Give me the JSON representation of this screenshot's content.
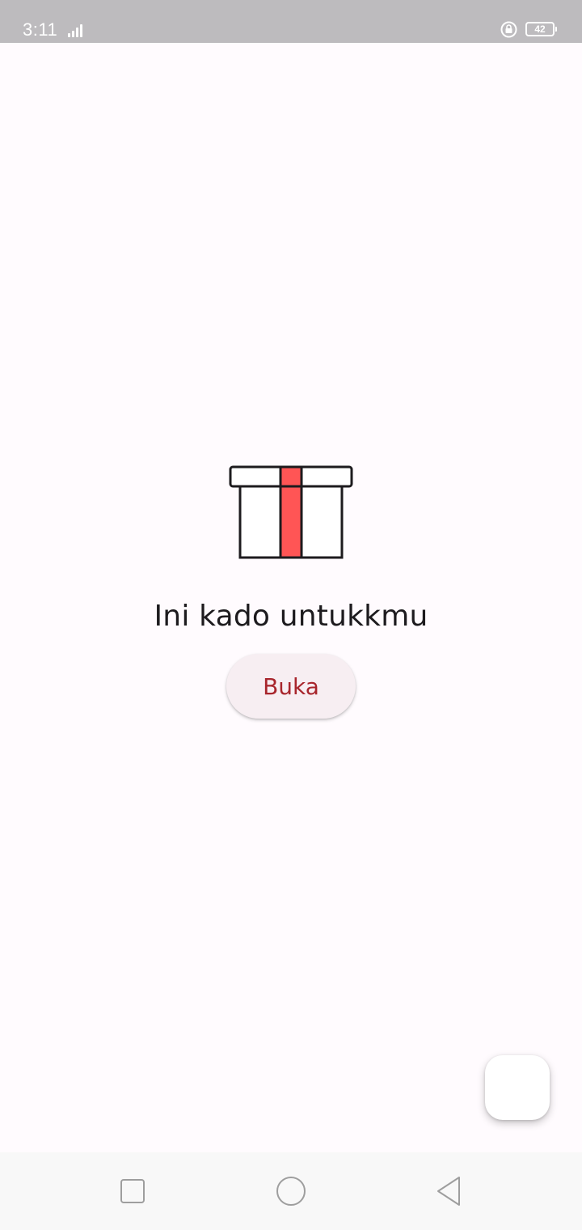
{
  "status_bar": {
    "time": "3:11",
    "battery_level": "42",
    "icons": [
      "signal-icon",
      "rotation-lock-icon",
      "battery-icon"
    ]
  },
  "main": {
    "icon": "gift-box-icon",
    "headline": "Ini kado untukkmu",
    "open_button_label": "Buka"
  },
  "fab": {
    "label": ""
  },
  "nav_bar": {
    "buttons": [
      "recent-apps-icon",
      "home-icon",
      "back-icon"
    ]
  },
  "colors": {
    "background": "#fffbfe",
    "ribbon": "#ff5555",
    "outline": "#1d1b1e",
    "button_text": "#a8262d",
    "button_bg": "#f7eef2",
    "status_bar": "#bdbbbe"
  }
}
